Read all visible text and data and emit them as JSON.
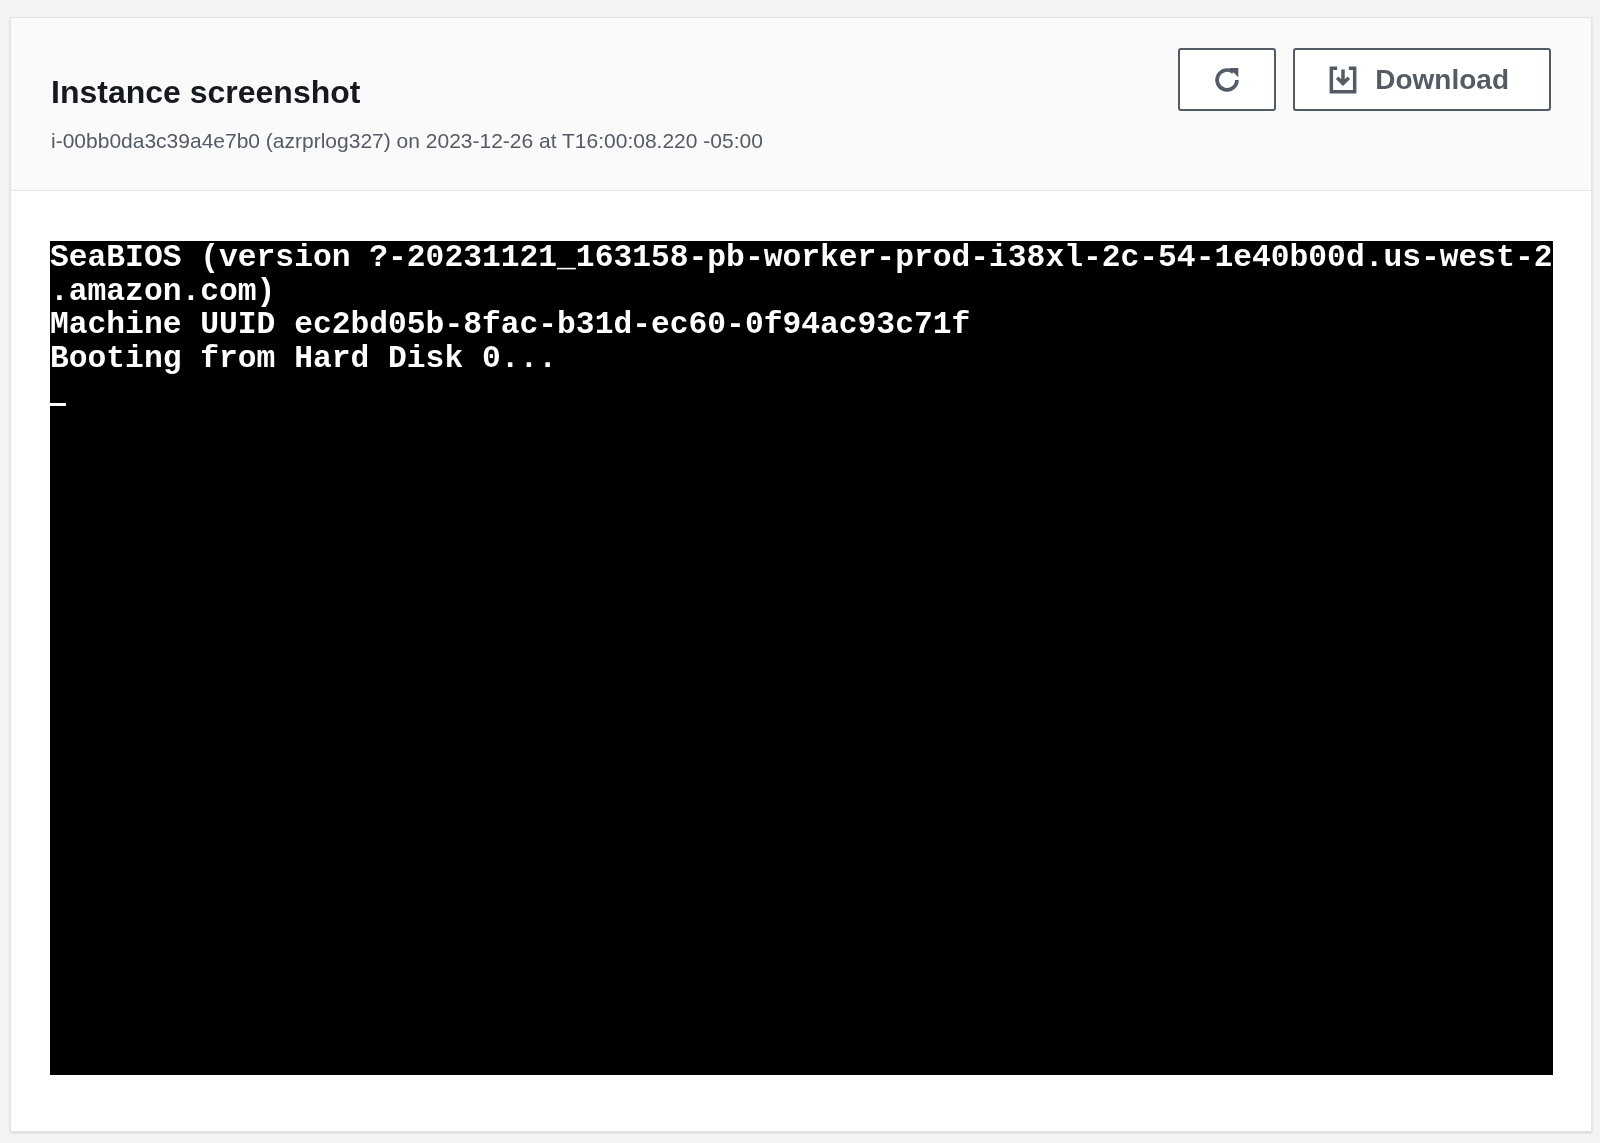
{
  "header": {
    "title": "Instance screenshot",
    "subtitle": "i-00bb0da3c39a4e7b0 (azrprlog327) on 2023-12-26 at T16:00:08.220 -05:00"
  },
  "buttons": [
    {
      "kind": "refresh"
    },
    {
      "kind": "download",
      "label": "Download"
    }
  ],
  "console": {
    "lines": [
      "SeaBIOS (version ?-20231121_163158-pb-worker-prod-i38xl-2c-54-1e40b00d.us-west-2",
      ".amazon.com)",
      "Machine UUID ec2bd05b-8fac-b31d-ec60-0f94ac93c71f",
      "Booting from Hard Disk 0..."
    ],
    "cursor": true
  }
}
